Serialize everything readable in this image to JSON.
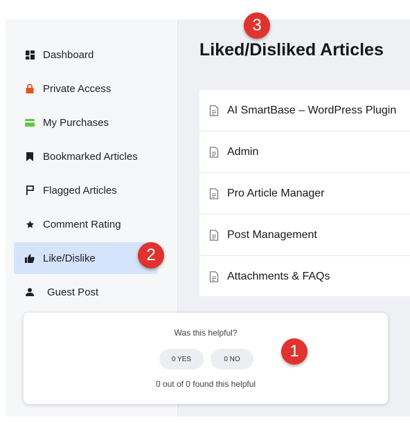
{
  "sidebar": {
    "items": [
      {
        "label": "Dashboard",
        "icon": "dashboard-icon",
        "icon_color": "#1d1f24"
      },
      {
        "label": "Private Access",
        "icon": "lock-icon",
        "icon_color": "#e8541c"
      },
      {
        "label": "My Purchases",
        "icon": "credit-card-icon",
        "icon_color": "#5cc94a"
      },
      {
        "label": "Bookmarked Articles",
        "icon": "bookmark-icon",
        "icon_color": "#1d1f24"
      },
      {
        "label": "Flagged Articles",
        "icon": "flag-icon",
        "icon_color": "#1d1f24"
      },
      {
        "label": "Comment Rating",
        "icon": "star-icon",
        "icon_color": "#1d1f24"
      },
      {
        "label": "Like/Dislike",
        "icon": "thumbs-up-icon",
        "icon_color": "#1d1f24",
        "active": true
      },
      {
        "label": "Guest Post",
        "icon": "user-icon",
        "icon_color": "#1d1f24"
      }
    ],
    "active_bg": "#d6e4fb"
  },
  "main": {
    "title": "Liked/Disliked Articles",
    "articles": [
      "AI SmartBase – WordPress Plugin",
      "Admin",
      "Pro Article Manager",
      "Post Management",
      "Attachments & FAQs"
    ]
  },
  "helpful": {
    "question": "Was this helpful?",
    "yes_label": "0 YES",
    "no_label": "0 NO",
    "summary": "0 out of 0 found this helpful"
  },
  "markers": {
    "one": "1",
    "two": "2",
    "three": "3",
    "color": "#e0322e"
  }
}
